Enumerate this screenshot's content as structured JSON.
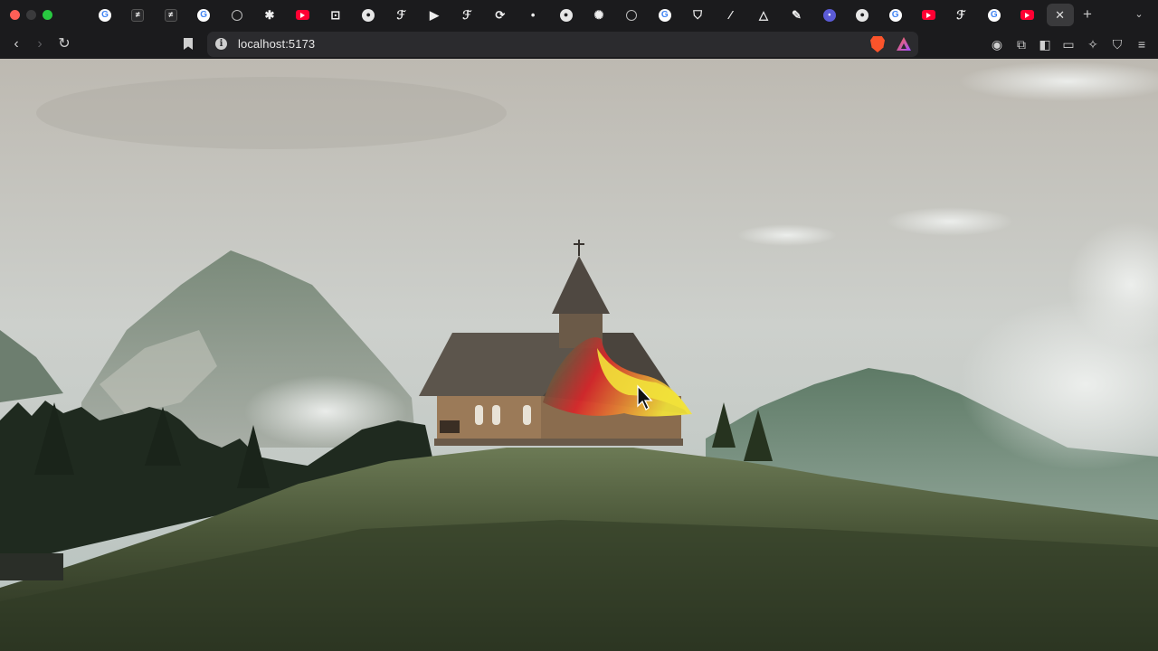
{
  "browser": {
    "url": "localhost:5173",
    "tabs": [
      {
        "icon": "google-icon",
        "glyph": "G",
        "style": "g"
      },
      {
        "icon": "app-icon",
        "glyph": "≠",
        "style": "dark"
      },
      {
        "icon": "app-icon",
        "glyph": "≠",
        "style": "dark"
      },
      {
        "icon": "grammarly-icon",
        "glyph": "G",
        "style": "g"
      },
      {
        "icon": "globe-icon",
        "glyph": "",
        "style": "globe"
      },
      {
        "icon": "asterisk-icon",
        "glyph": "✱",
        "style": "fr"
      },
      {
        "icon": "youtube-icon",
        "glyph": "",
        "style": "yt"
      },
      {
        "icon": "app-icon",
        "glyph": "⊡",
        "style": "fr"
      },
      {
        "icon": "github-icon",
        "glyph": "●",
        "style": "gh"
      },
      {
        "icon": "framer-icon",
        "glyph": "ℱ",
        "style": "fr"
      },
      {
        "icon": "play-icon",
        "glyph": "▶",
        "style": "fr"
      },
      {
        "icon": "framer-icon",
        "glyph": "ℱ",
        "style": "fr"
      },
      {
        "icon": "sync-icon",
        "glyph": "⟳",
        "style": "fr"
      },
      {
        "icon": "dot-icon",
        "glyph": "•",
        "style": "fr"
      },
      {
        "icon": "github-icon",
        "glyph": "●",
        "style": "gh"
      },
      {
        "icon": "openai-icon",
        "glyph": "✺",
        "style": "fr"
      },
      {
        "icon": "globe-icon",
        "glyph": "",
        "style": "globe"
      },
      {
        "icon": "google-icon",
        "glyph": "G",
        "style": "g"
      },
      {
        "icon": "shield-icon",
        "glyph": "⛉",
        "style": "fr"
      },
      {
        "icon": "app-icon",
        "glyph": "⁄",
        "style": "fr"
      },
      {
        "icon": "triangle-icon",
        "glyph": "△",
        "style": "fr"
      },
      {
        "icon": "app-icon",
        "glyph": "✎",
        "style": "fr"
      },
      {
        "icon": "app-icon",
        "glyph": "•",
        "style": "purple"
      },
      {
        "icon": "github-icon",
        "glyph": "●",
        "style": "gh"
      },
      {
        "icon": "google-icon",
        "glyph": "G",
        "style": "g"
      },
      {
        "icon": "youtube-icon",
        "glyph": "",
        "style": "yt"
      },
      {
        "icon": "framer-icon",
        "glyph": "ℱ",
        "style": "fr"
      },
      {
        "icon": "google-icon",
        "glyph": "G",
        "style": "g"
      },
      {
        "icon": "youtube-icon",
        "glyph": "",
        "style": "yt"
      },
      {
        "icon": "close-icon",
        "glyph": "✕",
        "style": "close-x",
        "active": true
      }
    ],
    "new_tab_glyph": "+",
    "tab_list_glyph": "⌄"
  },
  "colors": {
    "chrome_bg": "#1b1b1d",
    "urlbar_bg": "#2b2b2e",
    "brave_orange": "#fb542b",
    "smear_red": "#d8262a",
    "smear_yellow": "#f2e23a",
    "smear_green": "#1c7a4a"
  }
}
